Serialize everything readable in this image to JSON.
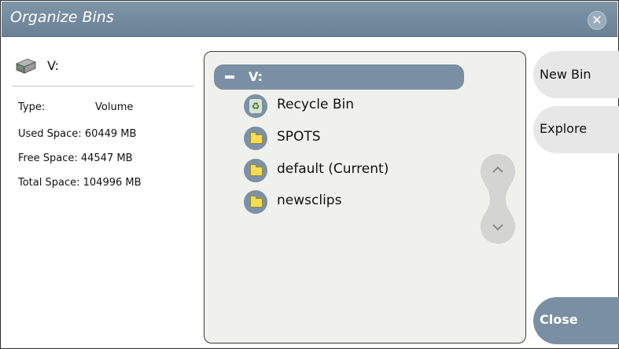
{
  "window": {
    "title": "Organize Bins",
    "close_symbol": "✕"
  },
  "volume": {
    "name": "V:",
    "icon": "drive-icon"
  },
  "info": {
    "type_label": "Type:",
    "type_value": "Volume",
    "used_label": "Used Space:",
    "used_value": "60449 MB",
    "free_label": "Free Space:",
    "free_value": "44547 MB",
    "total_label": "Total Space:",
    "total_value": "104996 MB"
  },
  "tree": {
    "root_label": "V:",
    "items": [
      {
        "label": "Recycle Bin",
        "icon": "recycle-bin-icon"
      },
      {
        "label": "SPOTS",
        "icon": "folder-icon"
      },
      {
        "label": "default (Current)",
        "icon": "folder-icon"
      },
      {
        "label": "newsclips",
        "icon": "folder-icon"
      }
    ]
  },
  "buttons": {
    "new_bin": "New Bin",
    "explore": "Explore",
    "close": "Close"
  },
  "colors": {
    "titlebar": "#6f8599",
    "selection": "#7a8fa3",
    "panel_bg": "#f0f0ed",
    "button_bg": "#e7e7e7"
  }
}
